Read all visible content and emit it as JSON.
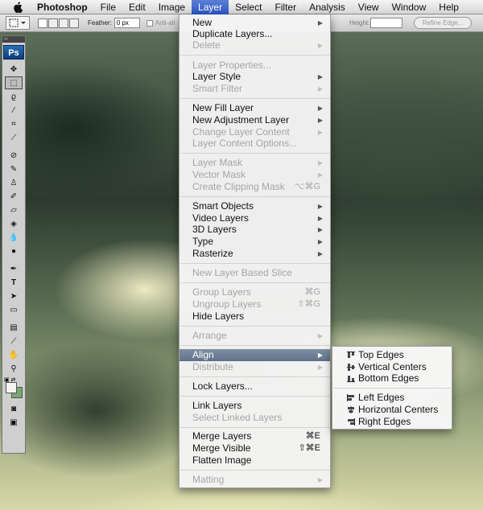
{
  "menubar": {
    "app": "Photoshop",
    "menus": [
      "File",
      "Edit",
      "Image",
      "Layer",
      "Select",
      "Filter",
      "Analysis",
      "View",
      "Window",
      "Help"
    ]
  },
  "options": {
    "feather_label": "Feather:",
    "feather_value": "0 px",
    "antialias_label": "Anti-ali",
    "height_label": "Height:",
    "refine_label": "Refine Edge..."
  },
  "tools": {
    "logo": "Ps"
  },
  "layer_menu": {
    "new": "New",
    "duplicate": "Duplicate Layers...",
    "delete": "Delete",
    "layer_properties": "Layer Properties...",
    "layer_style": "Layer Style",
    "smart_filter": "Smart Filter",
    "new_fill_layer": "New Fill Layer",
    "new_adjustment_layer": "New Adjustment Layer",
    "change_layer_content": "Change Layer Content",
    "layer_content_options": "Layer Content Options...",
    "layer_mask": "Layer Mask",
    "vector_mask": "Vector Mask",
    "create_clipping_mask": "Create Clipping Mask",
    "create_clipping_mask_shortcut": "⌥⌘G",
    "smart_objects": "Smart Objects",
    "video_layers": "Video Layers",
    "layers_3d": "3D Layers",
    "type": "Type",
    "rasterize": "Rasterize",
    "new_layer_based_slice": "New Layer Based Slice",
    "group_layers": "Group Layers",
    "group_layers_shortcut": "⌘G",
    "ungroup_layers": "Ungroup Layers",
    "ungroup_layers_shortcut": "⇧⌘G",
    "hide_layers": "Hide Layers",
    "arrange": "Arrange",
    "align": "Align",
    "distribute": "Distribute",
    "lock_layers": "Lock Layers...",
    "link_layers": "Link Layers",
    "select_linked_layers": "Select Linked Layers",
    "merge_layers": "Merge Layers",
    "merge_layers_shortcut": "⌘E",
    "merge_visible": "Merge Visible",
    "merge_visible_shortcut": "⇧⌘E",
    "flatten_image": "Flatten Image",
    "matting": "Matting"
  },
  "align_submenu": {
    "top_edges": "Top Edges",
    "vertical_centers": "Vertical Centers",
    "bottom_edges": "Bottom Edges",
    "left_edges": "Left Edges",
    "horizontal_centers": "Horizontal Centers",
    "right_edges": "Right Edges"
  },
  "colors": {
    "menu_highlight": "#2b56c4",
    "item_highlight": "#6a7c90",
    "foreground_swatch": "#f4f4f0",
    "background_swatch": "#7aa874"
  }
}
